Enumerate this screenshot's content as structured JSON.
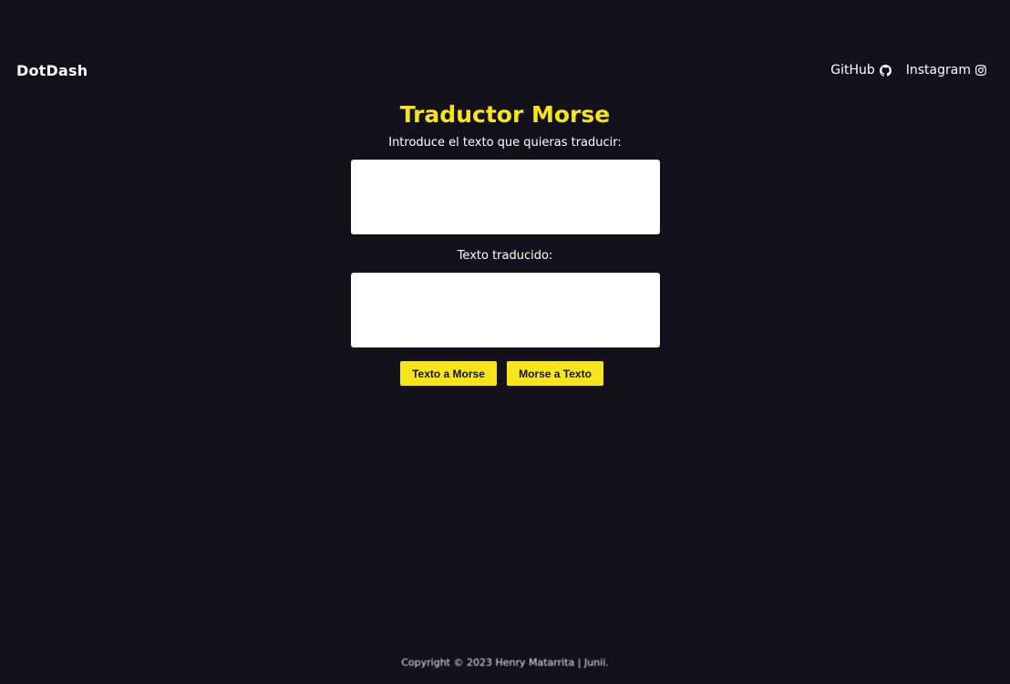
{
  "nav": {
    "brand": "DotDash",
    "links": [
      {
        "label": "GitHub",
        "icon": "github-icon"
      },
      {
        "label": "Instagram",
        "icon": "instagram-icon"
      }
    ]
  },
  "main": {
    "title": "Traductor Morse",
    "input_label": "Introduce el texto que quieras traducir:",
    "input_value": "",
    "output_label": "Texto traducido:",
    "output_value": "",
    "buttons": {
      "text_to_morse": "Texto a Morse",
      "morse_to_text": "Morse a Texto"
    }
  },
  "footer": {
    "copyright": "Copyright © 2023 Henry Matarrita | Junii."
  },
  "colors": {
    "background": "#13121c",
    "accent": "#f7e51c",
    "text": "#ffffff"
  }
}
